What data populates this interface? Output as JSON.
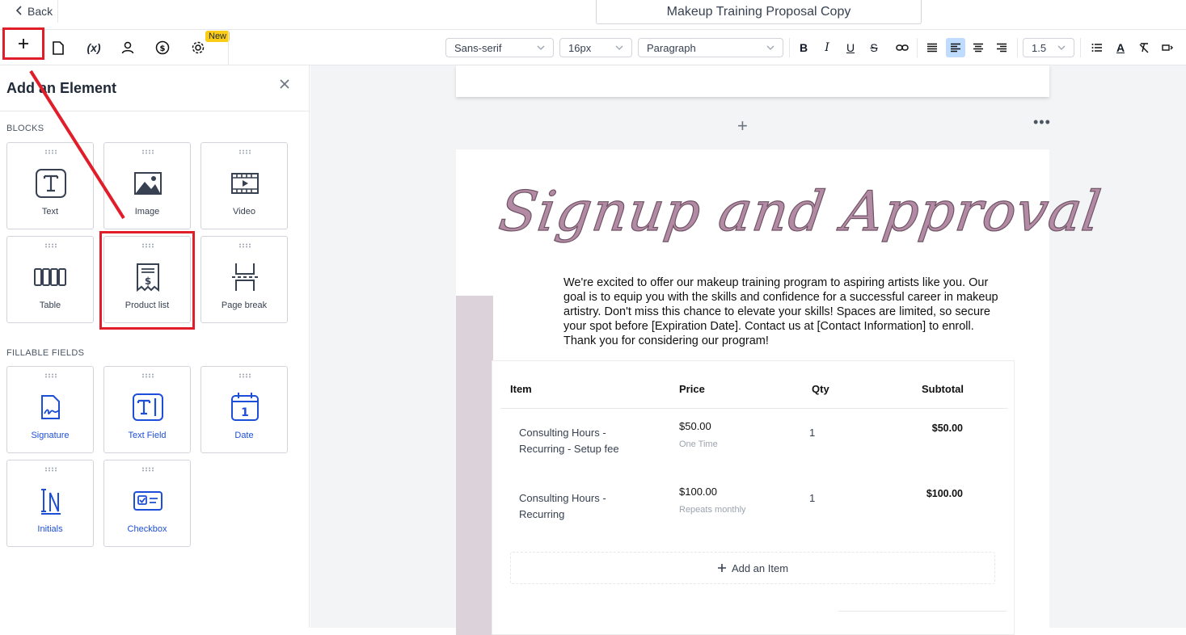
{
  "header": {
    "back_label": "Back",
    "doc_title": "Makeup Training Proposal Copy"
  },
  "toolbar": {
    "new_badge": "New",
    "font_family": "Sans-serif",
    "font_size": "16px",
    "block_type": "Paragraph",
    "line_height": "1.5",
    "icons": [
      "plus-icon",
      "file-icon",
      "variable-icon",
      "user-icon",
      "dollar-icon",
      "gear-icon",
      "bold-icon",
      "italic-icon",
      "underline-icon",
      "strikethrough-icon",
      "link-icon",
      "align-justify-icon",
      "align-left-icon",
      "align-center-icon",
      "align-right-icon",
      "list-icon",
      "font-color-icon",
      "clear-format-icon",
      "more-icon"
    ]
  },
  "sidebar": {
    "title": "Add an Element",
    "blocks_label": "BLOCKS",
    "blocks": [
      {
        "label": "Text",
        "icon": "text-icon"
      },
      {
        "label": "Image",
        "icon": "image-icon"
      },
      {
        "label": "Video",
        "icon": "video-icon"
      },
      {
        "label": "Table",
        "icon": "table-icon"
      },
      {
        "label": "Product list",
        "icon": "receipt-icon"
      },
      {
        "label": "Page break",
        "icon": "page-break-icon"
      }
    ],
    "fillable_label": "FILLABLE FIELDS",
    "fillable": [
      {
        "label": "Signature",
        "icon": "signature-icon"
      },
      {
        "label": "Text Field",
        "icon": "text-field-icon"
      },
      {
        "label": "Date",
        "icon": "calendar-icon"
      },
      {
        "label": "Initials",
        "icon": "initials-icon"
      },
      {
        "label": "Checkbox",
        "icon": "checkbox-icon"
      }
    ]
  },
  "document": {
    "heading": "Signup and Approval",
    "intro": "We're excited to offer our makeup training program to aspiring artists like you. Our goal is to equip you with the skills and confidence for a successful career in makeup artistry. Don't miss this chance to elevate your skills! Spaces are limited, so secure your spot before [Expiration Date]. Contact us at [Contact Information] to enroll. Thank you for considering our program!",
    "table": {
      "headers": [
        "Item",
        "Price",
        "Qty",
        "Subtotal"
      ],
      "rows": [
        {
          "item_line1": "Consulting Hours -",
          "item_line2": "Recurring - Setup fee",
          "price": "$50.00",
          "price_note": "One Time",
          "qty": "1",
          "subtotal": "$50.00"
        },
        {
          "item_line1": "Consulting Hours -",
          "item_line2": "Recurring",
          "price": "$100.00",
          "price_note": "Repeats monthly",
          "qty": "1",
          "subtotal": "$100.00"
        }
      ],
      "add_item_label": "Add an Item"
    }
  },
  "colors": {
    "accent_active": "#bfdbfe",
    "annotation_red": "#e11d2a",
    "field_blue": "#1d4ed8",
    "heading_mauve": "#b38aa4"
  }
}
